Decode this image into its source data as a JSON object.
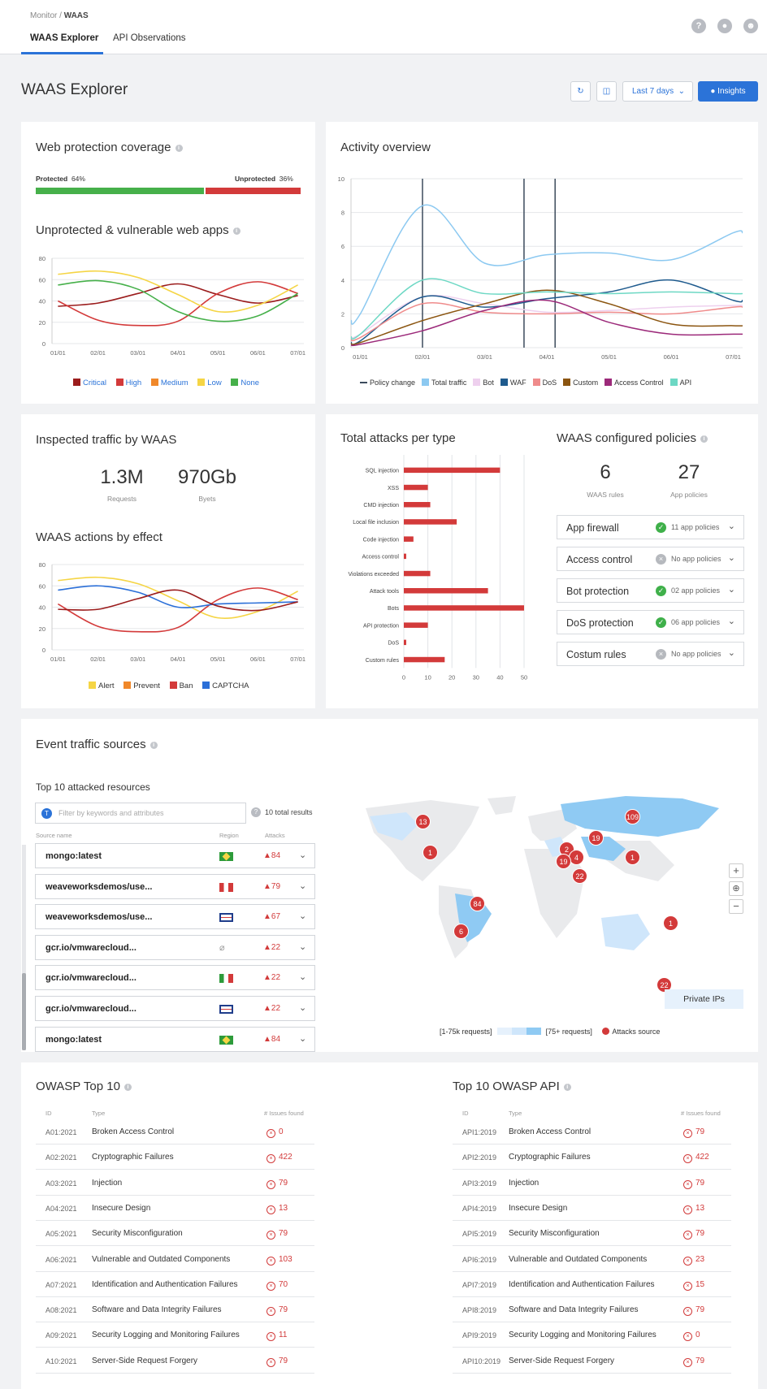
{
  "header": {
    "breadcrumb_parent": "Monitor /",
    "breadcrumb_current": "WAAS",
    "tabs": [
      "WAAS Explorer",
      "API Observations"
    ]
  },
  "page": {
    "title": "WAAS Explorer",
    "date_range": "Last 7 days",
    "insights": "Insights"
  },
  "coverage": {
    "title": "Web protection coverage",
    "protected_label": "Protected",
    "protected_pct": "64%",
    "unprotected_label": "Unprotected",
    "unprotected_pct": "36%",
    "protected_fraction": 0.64
  },
  "vuln": {
    "title": "Unprotected & vulnerable web apps",
    "chart_data": {
      "type": "line",
      "x": [
        "01/01",
        "02/01",
        "03/01",
        "04/01",
        "05/01",
        "06/01",
        "07/01"
      ],
      "ylim": [
        0,
        80
      ],
      "yticks": [
        0,
        20,
        40,
        60,
        80
      ],
      "series": [
        {
          "name": "Critical",
          "color": "#9b1c1c",
          "values": [
            35,
            38,
            47,
            56,
            46,
            38,
            45
          ]
        },
        {
          "name": "High",
          "color": "#d33a3a",
          "values": [
            40,
            22,
            17,
            21,
            47,
            58,
            47
          ]
        },
        {
          "name": "Medium",
          "color": "#f0882a",
          "values": [
            null,
            null,
            null,
            null,
            null,
            null,
            null
          ]
        },
        {
          "name": "Low",
          "color": "#f5d545",
          "values": [
            65,
            68,
            62,
            46,
            30,
            36,
            55
          ]
        },
        {
          "name": "None",
          "color": "#46b04a",
          "values": [
            55,
            59,
            51,
            30,
            21,
            26,
            47
          ]
        }
      ]
    }
  },
  "activity": {
    "title": "Activity overview",
    "chart_data": {
      "type": "line",
      "x": [
        "01/01",
        "02/01",
        "03/01",
        "04/01",
        "05/01",
        "06/01",
        "07/01"
      ],
      "ylim": [
        0,
        10
      ],
      "yticks": [
        0,
        2,
        4,
        6,
        8,
        10
      ],
      "policy_changes": [
        "02/01",
        "03/20",
        "04/05"
      ],
      "series": [
        {
          "name": "Total traffic",
          "color": "#8cc9f1",
          "values": [
            2,
            8.4,
            5,
            5.5,
            5.6,
            5.2,
            6.8
          ]
        },
        {
          "name": "Bot",
          "color": "#eed0ee",
          "values": [
            0.8,
            3,
            2.6,
            2.1,
            2.2,
            2.4,
            2.5
          ]
        },
        {
          "name": "WAF",
          "color": "#1f5b8e",
          "values": [
            0.4,
            3,
            2.4,
            2.9,
            3.3,
            4,
            2.8
          ]
        },
        {
          "name": "DoS",
          "color": "#ef8b8b",
          "values": [
            0.6,
            2.6,
            2.1,
            2,
            2.1,
            2,
            2.4
          ]
        },
        {
          "name": "Custom",
          "color": "#8b5510",
          "values": [
            0.3,
            1.6,
            2.6,
            3.4,
            2.6,
            1.4,
            1.3
          ]
        },
        {
          "name": "Access Control",
          "color": "#9c2a7a",
          "values": [
            0.2,
            1,
            2.2,
            2.8,
            1.5,
            0.8,
            0.8
          ]
        },
        {
          "name": "API",
          "color": "#6dd8c4",
          "values": [
            0.8,
            4,
            3.2,
            3.3,
            3.2,
            3.3,
            3.2
          ]
        }
      ],
      "legend": [
        "Policy change",
        "Total traffic",
        "Bot",
        "WAF",
        "DoS",
        "Custom",
        "Access Control",
        "API"
      ]
    }
  },
  "inspected": {
    "title": "Inspected traffic by WAAS",
    "requests_value": "1.3M",
    "requests_label": "Requests",
    "bytes_value": "970Gb",
    "bytes_label": "Byets"
  },
  "actions": {
    "title": "WAAS actions by effect",
    "chart_data": {
      "type": "line",
      "x": [
        "01/01",
        "02/01",
        "03/01",
        "04/01",
        "05/01",
        "06/01",
        "07/01"
      ],
      "ylim": [
        0,
        80
      ],
      "yticks": [
        0,
        20,
        40,
        60,
        80
      ],
      "series": [
        {
          "name": "Alert",
          "color": "#f5d545",
          "values": [
            65,
            68,
            62,
            46,
            30,
            36,
            55
          ]
        },
        {
          "name": "Prevent",
          "color": "#f0882a",
          "values": [
            null,
            null,
            null,
            null,
            null,
            null,
            null
          ]
        },
        {
          "name": "Ban",
          "color": "#d33a3a",
          "values": [
            43,
            22,
            17,
            21,
            47,
            58,
            47
          ]
        },
        {
          "name": "CAPTCHA",
          "color": "#2b6fd8",
          "values": [
            56,
            60,
            54,
            40,
            43,
            44,
            45
          ]
        },
        {
          "name": "",
          "color": "#9b1c1c",
          "values": [
            38,
            38,
            48,
            56,
            41,
            37,
            45
          ]
        }
      ]
    }
  },
  "attacks": {
    "title": "Total attacks per type",
    "chart_data": {
      "type": "bar",
      "orientation": "horizontal",
      "categories": [
        "SQL injection",
        "XSS",
        "CMD injection",
        "Local file inclusion",
        "Code injection",
        "Access control",
        "Violations exceeded",
        "Attack tools",
        "Bots",
        "API protection",
        "DoS",
        "Custom rules"
      ],
      "values": [
        40,
        10,
        11,
        22,
        4,
        1,
        11,
        35,
        50,
        10,
        1,
        17
      ],
      "xlim": [
        0,
        50
      ],
      "xticks": [
        0,
        10,
        20,
        30,
        40,
        50
      ]
    }
  },
  "policies": {
    "title": "WAAS configured policies",
    "rules_value": "6",
    "rules_label": "WAAS rules",
    "app_value": "27",
    "app_label": "App policies",
    "items": [
      {
        "name": "App firewall",
        "status": "11 app policies",
        "ok": true
      },
      {
        "name": "Access control",
        "status": "No app policies",
        "ok": false
      },
      {
        "name": "Bot protection",
        "status": "02 app policies",
        "ok": true
      },
      {
        "name": "DoS protection",
        "status": "06 app policies",
        "ok": true
      },
      {
        "name": "Costum rules",
        "status": "No app policies",
        "ok": false
      }
    ]
  },
  "events": {
    "title": "Event traffic sources",
    "top_title": "Top 10 attacked resources",
    "filter_placeholder": "Filter by keywords and attributes",
    "total_results": "10 total results",
    "col_source": "Source name",
    "col_region": "Region",
    "col_attacks": "Attacks",
    "rows": [
      {
        "name": "mongo:latest",
        "flag": "br",
        "attacks": "84"
      },
      {
        "name": "weaveworksdemos/use...",
        "flag": "pe",
        "attacks": "79"
      },
      {
        "name": "weaveworksdemos/use...",
        "flag": "gb",
        "attacks": "67"
      },
      {
        "name": "gcr.io/vmwarecloud...",
        "flag": "none",
        "attacks": "22"
      },
      {
        "name": "gcr.io/vmwarecloud...",
        "flag": "it",
        "attacks": "22"
      },
      {
        "name": "gcr.io/vmwarecloud...",
        "flag": "gb",
        "attacks": "22"
      },
      {
        "name": "mongo:latest",
        "flag": "br",
        "attacks": "84"
      }
    ],
    "map_badges": [
      "13",
      "1",
      "84",
      "6",
      "109",
      "19",
      "2",
      "4",
      "19",
      "22",
      "1",
      "1",
      "22"
    ],
    "private_ips": "Private IPs",
    "legend_low": "[1-75k requests]",
    "legend_high": "[75+ requests]",
    "legend_source": "Attacks source"
  },
  "owasp": {
    "title": "OWASP Top 10",
    "col_id": "ID",
    "col_type": "Type",
    "col_issues": "# Issues found",
    "rows": [
      [
        "A01:2021",
        "Broken Access Control",
        "0"
      ],
      [
        "A02:2021",
        "Cryptographic Failures",
        "422"
      ],
      [
        "A03:2021",
        "Injection",
        "79"
      ],
      [
        "A04:2021",
        "Insecure Design",
        "13"
      ],
      [
        "A05:2021",
        "Security Misconfiguration",
        "79"
      ],
      [
        "A06:2021",
        "Vulnerable and Outdated Components",
        "103"
      ],
      [
        "A07:2021",
        "Identification and Authentication Failures",
        "70"
      ],
      [
        "A08:2021",
        "Software and Data Integrity Failures",
        "79"
      ],
      [
        "A09:2021",
        "Security Logging and Monitoring Failures",
        "11"
      ],
      [
        "A10:2021",
        "Server-Side Request Forgery",
        "79"
      ]
    ]
  },
  "owasp_api": {
    "title": "Top 10 OWASP API",
    "col_id": "ID",
    "col_type": "Type",
    "col_issues": "# Issues found",
    "rows": [
      [
        "API1:2019",
        "Broken Access Control",
        "79"
      ],
      [
        "API2:2019",
        "Cryptographic Failures",
        "422"
      ],
      [
        "API3:2019",
        "Injection",
        "79"
      ],
      [
        "API4:2019",
        "Insecure Design",
        "13"
      ],
      [
        "API5:2019",
        "Security Misconfiguration",
        "79"
      ],
      [
        "API6:2019",
        "Vulnerable and Outdated Components",
        "23"
      ],
      [
        "API7:2019",
        "Identification and Authentication Failures",
        "15"
      ],
      [
        "API8:2019",
        "Software and Data Integrity Failures",
        "79"
      ],
      [
        "API9:2019",
        "Security Logging and Monitoring Failures",
        "0"
      ],
      [
        "API10:2019",
        "Server-Side Request Forgery",
        "79"
      ]
    ]
  }
}
